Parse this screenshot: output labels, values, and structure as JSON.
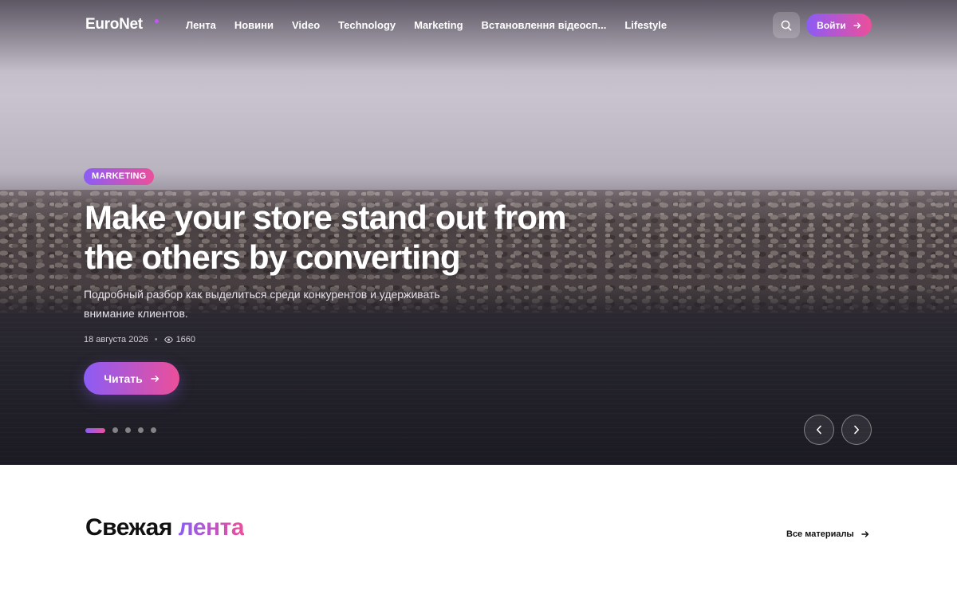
{
  "header": {
    "logo": "EuroNet",
    "nav": [
      "Лента",
      "Новини",
      "Video",
      "Technology",
      "Marketing",
      "Встановлення відеосп...",
      "Lifestyle"
    ],
    "login_label": "Войти"
  },
  "hero": {
    "badge": "MARKETING",
    "title": "Make your store stand out from the others by converting",
    "description": "Подробный разбор как выделиться среди конкурентов и удерживать внимание клиентов.",
    "date": "18 августа 2026",
    "views": "1660",
    "read_label": "Читать",
    "slides_total": 5,
    "active_slide": 1
  },
  "feed": {
    "title_part1": "Свежая",
    "title_part2": "лента",
    "all_link": "Все материалы"
  },
  "colors": {
    "accent_start": "#8b5cf6",
    "accent_end": "#ec4f9a"
  }
}
